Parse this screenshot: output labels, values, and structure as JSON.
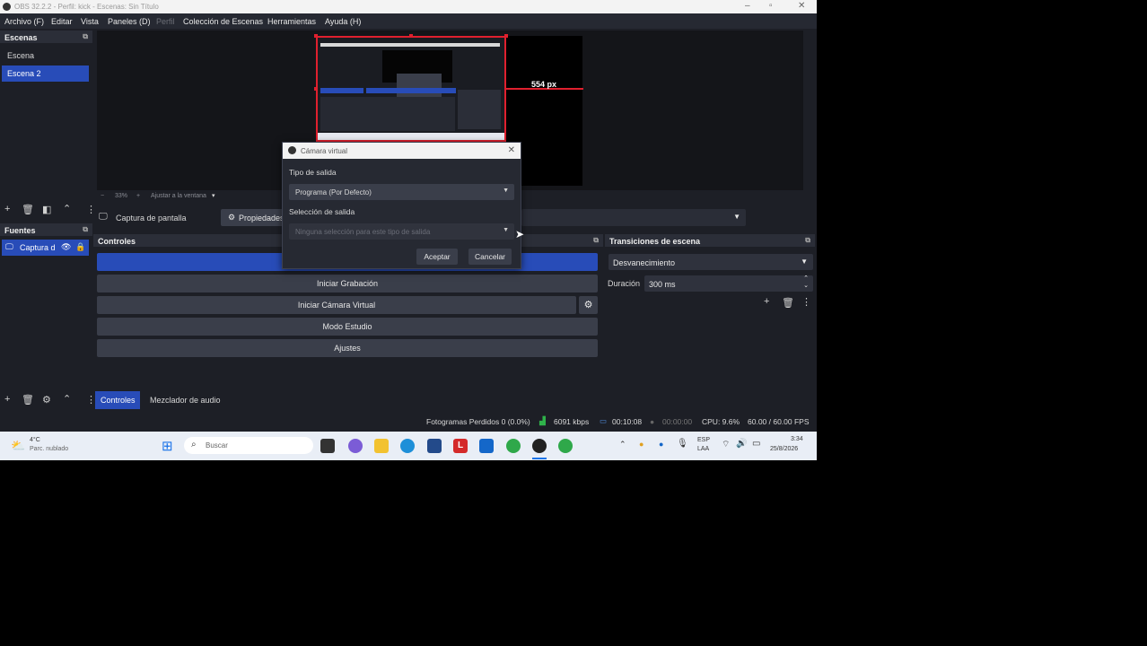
{
  "window": {
    "title": "OBS 32.2.2 - Perfil: kick - Escenas: Sin Título"
  },
  "menu": {
    "items": [
      "Archivo (F)",
      "Editar",
      "Vista",
      "Paneles (D)",
      "Perfil",
      "Colección de Escenas",
      "Herramientas",
      "Ayuda (H)"
    ]
  },
  "scenes": {
    "header": "Escenas",
    "items": [
      "Escena",
      "Escena 2"
    ],
    "selected_index": 1
  },
  "sources": {
    "header": "Fuentes",
    "items": [
      "Captura d"
    ]
  },
  "preview": {
    "zoom_text": "33%",
    "fit_text": "Ajustar a la ventana",
    "px_label": "554 px"
  },
  "source_toolbar": {
    "source_name": "Captura de pantalla",
    "properties_label": "Propiedades"
  },
  "controls": {
    "header": "Controles",
    "buttons": [
      "Iniciar Grabación",
      "Iniciar Cámara Virtual",
      "Modo Estudio",
      "Ajustes"
    ]
  },
  "transitions": {
    "header": "Transiciones de escena",
    "selected": "Desvanecimiento",
    "duration_label": "Duración",
    "duration_value": "300 ms"
  },
  "bottom_tabs": {
    "tab1": "Controles",
    "tab2": "Mezclador de audio"
  },
  "dialog": {
    "title": "Cámara virtual",
    "output_type_label": "Tipo de salida",
    "output_type_value": "Programa (Por Defecto)",
    "output_selection_label": "Selección de salida",
    "output_selection_value": "Ninguna selección para este tipo de salida",
    "accept": "Aceptar",
    "cancel": "Cancelar"
  },
  "status": {
    "dropped_frames": "Fotogramas Perdidos 0 (0.0%)",
    "bitrate": "6091 kbps",
    "stream_time": "00:10:08",
    "rec_time": "00:00:00",
    "cpu": "CPU: 9.6%",
    "fps": "60.00 / 60.00 FPS"
  },
  "taskbar": {
    "weather_temp": "4°C",
    "weather_desc": "Parc. nublado",
    "search_placeholder": "Buscar",
    "lang_top": "ESP",
    "lang_bottom": "LAA",
    "time": "3:34",
    "date": "25/8/2026"
  },
  "colors": {
    "accent_blue": "#284cb8",
    "selection_red": "#e0202e"
  }
}
